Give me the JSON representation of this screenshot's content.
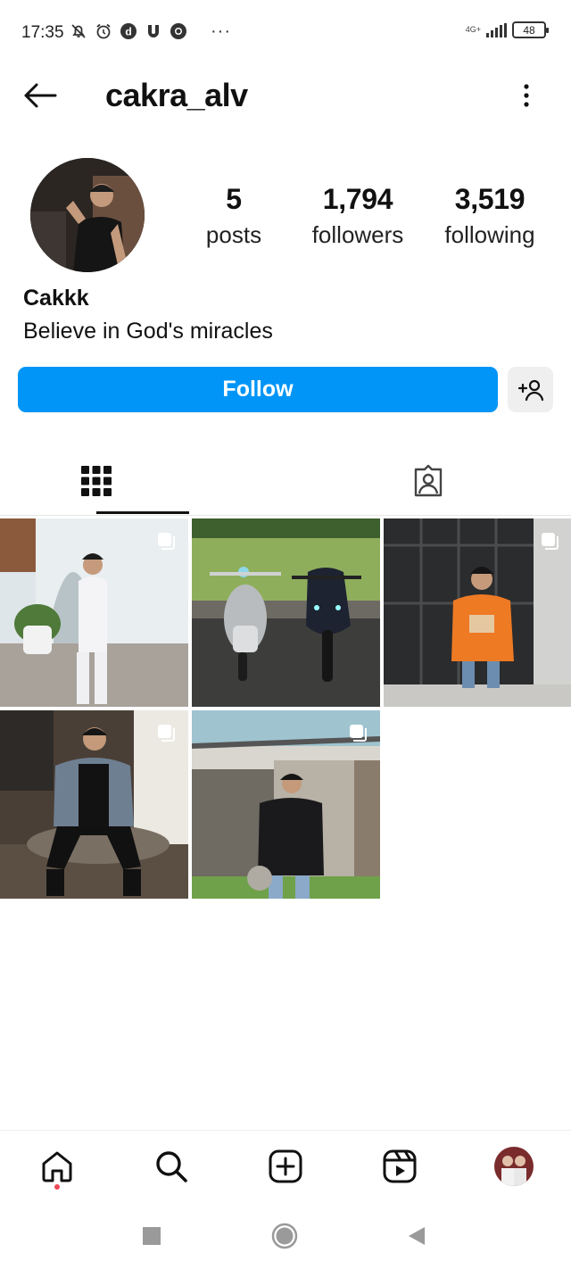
{
  "status_bar": {
    "time": "17:35",
    "overflow": "···",
    "network": "4G+",
    "battery": "48",
    "icons": [
      "bell-off-icon",
      "alarm-icon",
      "d-app-icon",
      "u-app-icon",
      "chrome-icon"
    ]
  },
  "header": {
    "username": "cakra_alv",
    "back_icon": "arrow-left-icon",
    "more_icon": "more-vertical-icon"
  },
  "profile": {
    "stats": [
      {
        "value": "5",
        "label": "posts"
      },
      {
        "value": "1,794",
        "label": "followers"
      },
      {
        "value": "3,519",
        "label": "following"
      }
    ],
    "display_name": "Cakkk",
    "bio": "Believe in God's miracles",
    "follow_label": "Follow",
    "suggest_icon": "add-person-icon"
  },
  "tabs": [
    {
      "name": "posts-grid",
      "icon": "grid-icon",
      "active": true
    },
    {
      "name": "tagged",
      "icon": "tagged-person-icon",
      "active": false
    }
  ],
  "posts": [
    {
      "multiple": true
    },
    {
      "multiple": false
    },
    {
      "multiple": true
    },
    {
      "multiple": true
    },
    {
      "multiple": true
    }
  ],
  "bottom_nav": [
    {
      "name": "home",
      "icon": "home-icon",
      "has_notification_dot": true
    },
    {
      "name": "search",
      "icon": "search-icon"
    },
    {
      "name": "create",
      "icon": "plus-square-icon"
    },
    {
      "name": "reels",
      "icon": "reels-icon"
    },
    {
      "name": "profile",
      "icon": "profile-avatar"
    }
  ],
  "colors": {
    "accent": "#0095f6",
    "notification": "#ed4956",
    "text": "#111111"
  }
}
